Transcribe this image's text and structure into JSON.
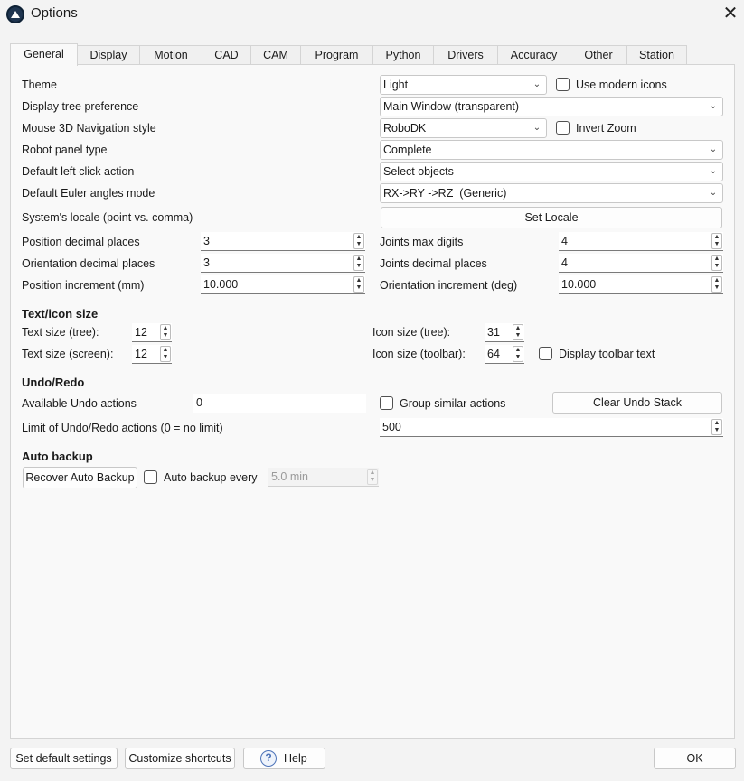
{
  "window": {
    "title": "Options",
    "close_icon": "close-icon",
    "app_icon": "robodk-logo-icon"
  },
  "tabs": [
    {
      "label": "General",
      "active": true
    },
    {
      "label": "Display"
    },
    {
      "label": "Motion"
    },
    {
      "label": "CAD"
    },
    {
      "label": "CAM"
    },
    {
      "label": "Program"
    },
    {
      "label": "Python"
    },
    {
      "label": "Drivers"
    },
    {
      "label": "Accuracy"
    },
    {
      "label": "Other"
    },
    {
      "label": "Station"
    }
  ],
  "general": {
    "theme": {
      "label": "Theme",
      "value": "Light",
      "modern_icons_label": "Use modern icons",
      "modern_icons_checked": false
    },
    "display_tree": {
      "label": "Display tree preference",
      "value": "Main Window (transparent)"
    },
    "mouse_nav": {
      "label": "Mouse 3D Navigation style",
      "value": "RoboDK",
      "invert_zoom_label": "Invert Zoom",
      "invert_zoom_checked": false
    },
    "robot_panel": {
      "label": "Robot panel type",
      "value": "Complete"
    },
    "left_click": {
      "label": "Default left click action",
      "value": "Select objects"
    },
    "euler": {
      "label": "Default Euler angles mode",
      "value": "RX->RY ->RZ  (Generic)"
    },
    "locale": {
      "label": "System's locale (point vs. comma)",
      "button": "Set Locale"
    },
    "position_decimals": {
      "label": "Position decimal places",
      "value": "3"
    },
    "joints_max_digits": {
      "label": "Joints max digits",
      "value": "4"
    },
    "orientation_decimals": {
      "label": "Orientation decimal places",
      "value": "3"
    },
    "joints_decimals": {
      "label": "Joints decimal places",
      "value": "4"
    },
    "position_increment": {
      "label": "Position increment (mm)",
      "value": "10.000"
    },
    "orientation_increment": {
      "label": "Orientation increment (deg)",
      "value": "10.000"
    }
  },
  "text_icon": {
    "heading": "Text/icon size",
    "text_tree": {
      "label": "Text size (tree):",
      "value": "12"
    },
    "icon_tree": {
      "label": "Icon size (tree):",
      "value": "31"
    },
    "text_screen": {
      "label": "Text size (screen):",
      "value": "12"
    },
    "icon_toolbar": {
      "label": "Icon size (toolbar):",
      "value": "64"
    },
    "toolbar_text": {
      "label": "Display toolbar text",
      "checked": false
    }
  },
  "undo": {
    "heading": "Undo/Redo",
    "available": {
      "label": "Available Undo actions",
      "value": "0"
    },
    "group_similar": {
      "label": "Group similar actions",
      "checked": false
    },
    "clear_button": "Clear Undo Stack",
    "limit": {
      "label": "Limit of Undo/Redo actions (0 = no limit)",
      "value": "500"
    }
  },
  "backup": {
    "heading": "Auto backup",
    "recover_button": "Recover Auto Backup",
    "auto_every": {
      "label": "Auto backup every",
      "checked": false,
      "value": "5.0 min"
    }
  },
  "footer": {
    "default_settings": "Set default settings",
    "shortcuts": "Customize shortcuts",
    "help": "Help",
    "help_icon": "question-mark-icon",
    "ok": "OK"
  },
  "colors": {
    "background": "#f3f3f3",
    "panel": "#f9f9f9",
    "border": "#d4d4d4",
    "help_accent": "#4b72b8"
  }
}
